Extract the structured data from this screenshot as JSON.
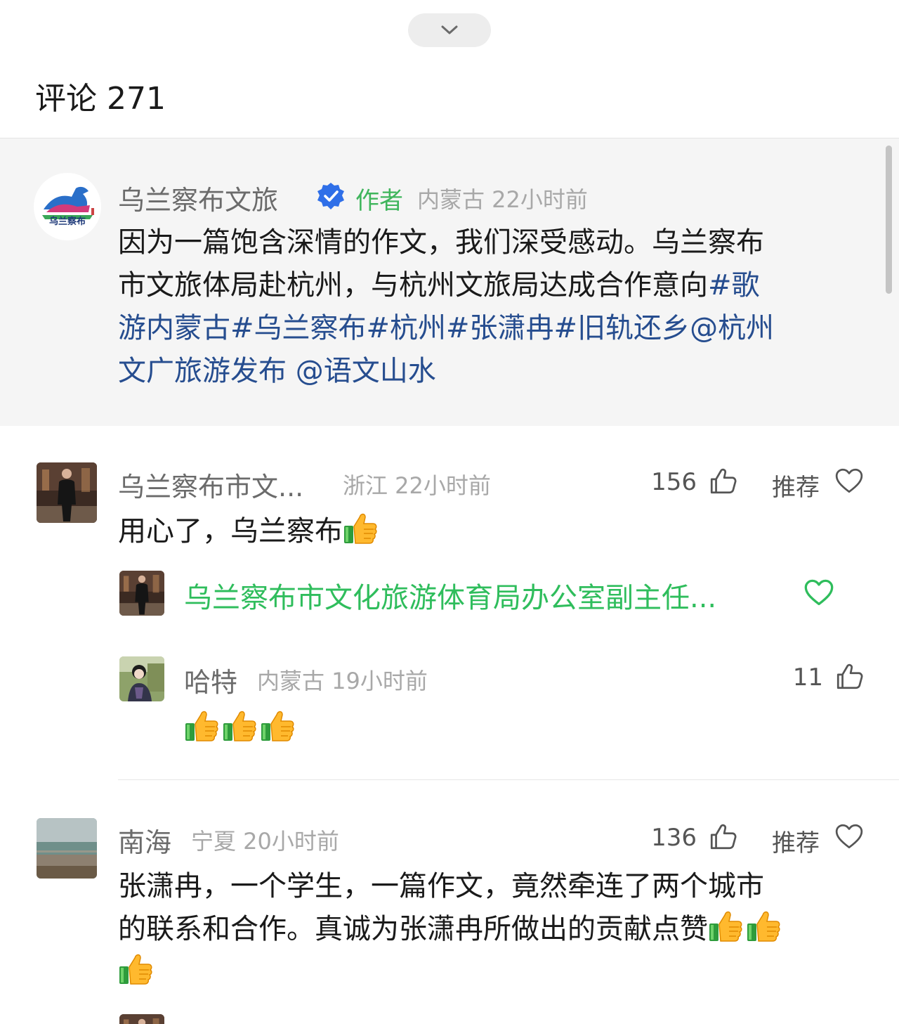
{
  "header": {
    "title": "评论 271",
    "collapse_icon": "chevron-down-icon"
  },
  "pinned": {
    "logo_text": "乌兰察布",
    "name": "乌兰察布文旅",
    "verified_icon": "verified-badge-icon",
    "author_tag": "作者",
    "location_time": "内蒙古 22小时前",
    "lines": [
      "因为一篇饱含深情的作文，我们深受感动。乌兰察布",
      "市文旅体局赴杭州，与杭州文旅局达成合作意向",
      "#歌",
      "游内蒙古",
      "#乌兰察布",
      "#杭州",
      "#张潇冉",
      "#旧轨还乡",
      "@杭州",
      "文广旅游发布 @语文山水"
    ]
  },
  "comments": [
    {
      "name": "乌兰察布市文...",
      "location_time": "浙江 22小时前",
      "likes": "156",
      "recommend": "推荐",
      "text": "用心了，乌兰察布",
      "reply_summary": "乌兰察布市文化旅游体育局办公室副主任..."
    },
    {
      "name": "哈特",
      "location_time": "内蒙古 19小时前",
      "likes": "11"
    },
    {
      "name": "南海",
      "location_time": "宁夏 20小时前",
      "likes": "136",
      "recommend": "推荐",
      "line1": "张潇冉，一个学生，一篇作文，竟然牵连了两个城市",
      "line2": "的联系和合作。真诚为张潇冉所做出的贡献点赞"
    }
  ],
  "icons": {
    "like": "thumbs-up-outline-icon",
    "heart": "heart-outline-icon",
    "emoji": "thumbs-up-emoji-icon"
  },
  "colors": {
    "topic_link": "#264d8f",
    "author_green": "#3fb55c",
    "reply_green": "#2fbd5c",
    "verified_blue": "#2f6fe8"
  }
}
